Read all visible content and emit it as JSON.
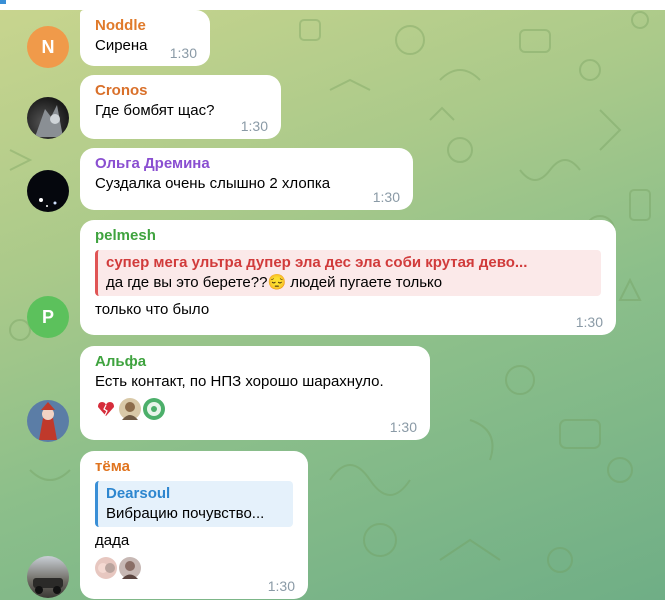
{
  "messages": [
    {
      "name": "Noddle",
      "text": "Сирена",
      "time": "1:30",
      "avatar_letter": "N",
      "name_color": "#e07a2a",
      "avatar_color": "#f09a4a"
    },
    {
      "name": "Cronos",
      "text": "Где бомбят щас?",
      "time": "1:30",
      "name_color": "#d9702a"
    },
    {
      "name": "Ольга Дремина",
      "text": "Суздалка очень слышно 2 хлопка",
      "time": "1:30",
      "name_color": "#8a4fd1"
    },
    {
      "name": "pelmesh",
      "avatar_letter": "P",
      "name_color": "#3fa33f",
      "avatar_color": "#5cc15c",
      "reply": {
        "name": "супер мега ультра дупер эла дес эла соби крутая дево...",
        "text": "да где вы это берете??😔 людей пугаете только"
      },
      "text": "только что было",
      "time": "1:30"
    },
    {
      "name": "Альфа",
      "text": "Есть контакт, по НПЗ хорошо шарахнуло.",
      "time": "1:30",
      "name_color": "#3fa33f",
      "reactions": [
        "broken-heart-icon",
        "user-face-icon",
        "user-face-icon"
      ]
    },
    {
      "name": "тёма",
      "name_color": "#e0741f",
      "reply": {
        "name": "Dearsoul",
        "text": "Вибрацию почувство..."
      },
      "text": "дада",
      "time": "1:30",
      "reactions": [
        "user-face-icon",
        "user-face-icon"
      ]
    }
  ]
}
